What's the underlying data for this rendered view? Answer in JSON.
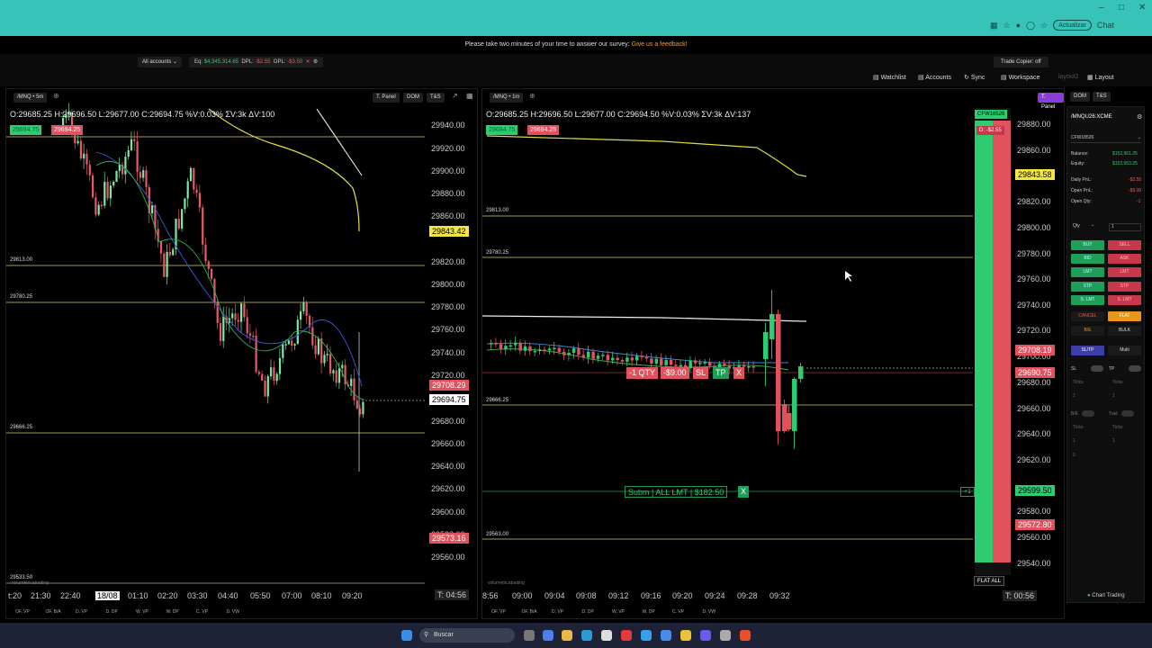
{
  "browser": {
    "chat_label": "Chat",
    "update_label": "Actualizar"
  },
  "survey": {
    "text": "Please take two minutes of your time to answer our survey:",
    "link": "Give us a feedback!"
  },
  "account": {
    "selector": "All accounts",
    "eq_label": "Eq:",
    "eq_value": "$4,345,314.65",
    "dpl_label": "DPL:",
    "dpl_value": "-$2.55",
    "opl_label": "OPL:",
    "opl_value": "-$3.50",
    "trade_copier": "Trade Copier: off"
  },
  "menu": {
    "watchlist": "Watchlist",
    "accounts": "Accounts",
    "sync": "Sync",
    "workspace": "Workspace",
    "layout": "Layout",
    "ghost": "layout2"
  },
  "chart_left": {
    "symbol": "/MNQ • 5m",
    "buttons": [
      "T. Panel",
      "DOM",
      "T&S"
    ],
    "ohlc": "O:29685.25  H:29696.50  L:29677.00  C:29694.75  %V:0.03%  ΣV:3k  ΔV:100",
    "tag_green": "29694.75",
    "tag_red": "29694.25",
    "price_labels": [
      "29940.00",
      "29920.00",
      "29900.00",
      "29880.00",
      "29860.00",
      "29820.00",
      "29800.00",
      "29780.00",
      "29760.00",
      "29740.00",
      "29720.00",
      "29680.00",
      "29660.00",
      "29640.00",
      "29620.00",
      "29600.00",
      "29580.00",
      "29560.00"
    ],
    "tag_yellow": "29843.42",
    "tag_red_price": "29708.29",
    "tag_white_price": "29694.75",
    "tag_red_low": "29573.16",
    "hlines": [
      "29813.00",
      "29780.25",
      "29666.25",
      "29533.50"
    ],
    "times": [
      "t:20",
      "21:30",
      "22:40",
      "18/08",
      "01:10",
      "02:20",
      "03:30",
      "04:40",
      "05:50",
      "07:00",
      "08:10",
      "09:20"
    ],
    "timer": "T: 04:56",
    "opts": [
      "OF. VP",
      "OF. B/A",
      "D. VP",
      "D. DP",
      "W. VP",
      "W. DP",
      "C. VP",
      "D. VW"
    ],
    "watermark": "volumetricatrading"
  },
  "chart_right": {
    "symbol": "/MNQ • 1m",
    "buttons": [
      "T. Panel",
      "DOM",
      "T&S"
    ],
    "ohlc": "O:29685.25  H:29696.50  L:29677.00  C:29694.50  %V:0.03%  ΣV:3k  ΔV:137",
    "tag_green": "29694.75",
    "tag_red": "29694.25",
    "price_labels": [
      "29880.00",
      "29860.00",
      "29840.00",
      "29820.00",
      "29800.00",
      "29780.00",
      "29760.00",
      "29740.00",
      "29720.00",
      "29700.00",
      "29680.00",
      "29660.00",
      "29640.00",
      "29620.00",
      "29580.00",
      "29560.00",
      "29540.00"
    ],
    "tag_yellow": "29843.58",
    "tag_red_price": "29708.19",
    "tag_red_current": "29690.75",
    "tag_green_low": "29599.50",
    "tag_red_low": "29572.80",
    "hlines": [
      "29813.00",
      "29780.25",
      "29666.25",
      "29563.00"
    ],
    "times": [
      "8:56",
      "09:00",
      "09:04",
      "09:08",
      "09:12",
      "09:16",
      "09:20",
      "09:24",
      "09:28",
      "09:32"
    ],
    "timer": "T: 00:56",
    "opts": [
      "OF. VP",
      "OF. B/A",
      "D. VP",
      "D. DP",
      "W. VP",
      "W. DP",
      "C. VP",
      "D. VW"
    ],
    "order_qty": "-1 QTY",
    "order_pnl": "-$9.00",
    "order_sl": "SL",
    "order_tp": "TP",
    "order_x": "X",
    "submit_label": "Subm | ALL LMT | $182.50",
    "submit_x": "X",
    "plus_one": "+1",
    "dom_account": "CFW18526",
    "dom_pnl": "D: -$2.55",
    "flat_all": "FLAT ALL",
    "watermark": "volumetricatrading"
  },
  "sidebar": {
    "symbol": "/MNQU26:XCME",
    "account": "CFW18526",
    "balance_label": "Balance:",
    "balance": "$152,961.25",
    "equity_label": "Equity:",
    "equity": "$152,953.25",
    "daily_label": "Daily PnL:",
    "daily": "-$2.55",
    "open_label": "Open PnL:",
    "open": "-$9.00",
    "openqty_label": "Open Qty:",
    "openqty": "-1",
    "qty_label": "Qty",
    "qty_value": "1",
    "buttons": {
      "buy": "BUY",
      "sell": "SELL",
      "bid": "BID",
      "ask": "ASK",
      "lmt_b": "LMT",
      "lmt_s": "LMT",
      "stp_b": "STP",
      "stp_s": "STP",
      "slmt_b": "S. LMT",
      "slmt_s": "S. LMT",
      "cancel": "CANCEL",
      "flat": "FLAT",
      "be": "B/E",
      "bulk": "BULK",
      "sltp": "SL/TP",
      "multi": "Multi"
    },
    "sl_label": "SL",
    "tp_label": "TP",
    "ticks_label": "Ticks",
    "be_label": "B/E",
    "trail_label": "Trail",
    "zero": "0",
    "one": "1",
    "chart_trading": "Chart Trading"
  },
  "taskbar": {
    "search": "Buscar"
  },
  "colors": {
    "accent_teal": "#38c3b8",
    "buy_green": "#2ecc71",
    "sell_red": "#e2525e",
    "level_yellow": "#f5e642",
    "flat_orange": "#e8971a"
  }
}
